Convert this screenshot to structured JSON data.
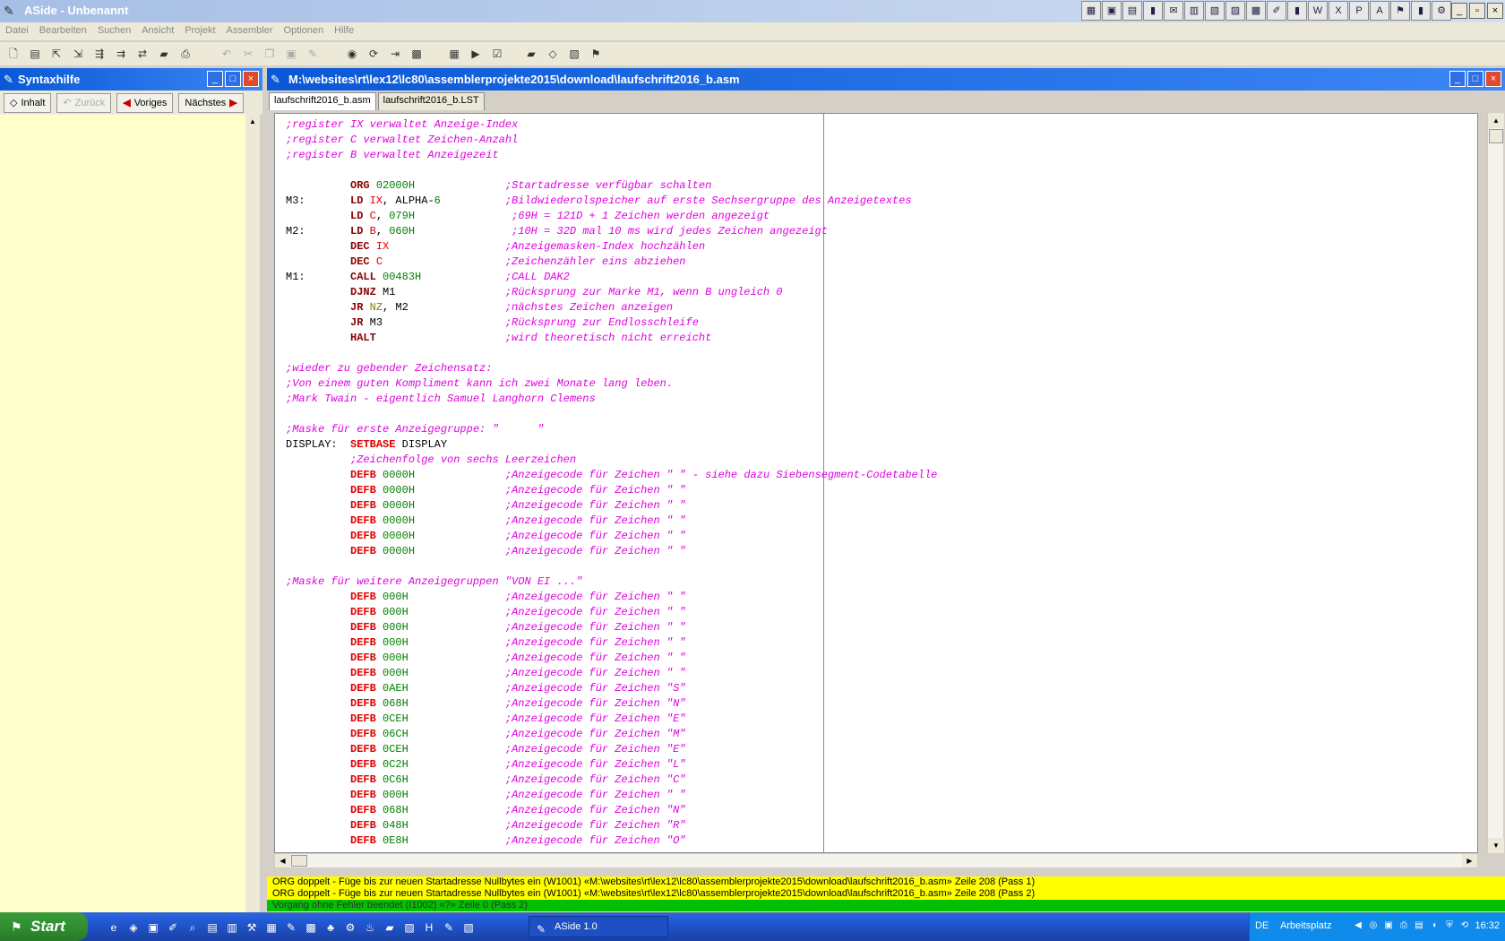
{
  "window": {
    "title": "ASide - Unbenannt"
  },
  "menu": [
    "Datei",
    "Bearbeiten",
    "Suchen",
    "Ansicht",
    "Projekt",
    "Assembler",
    "Optionen",
    "Hilfe"
  ],
  "syntax_panel": {
    "title": "Syntaxhilfe",
    "buttons": {
      "inhalt": "Inhalt",
      "zurueck": "Zurück",
      "voriges": "Voriges",
      "naechstes": "Nächstes"
    }
  },
  "editor": {
    "title": "M:\\websites\\rt\\lex12\\lc80\\assemblerprojekte2015\\download\\laufschrift2016_b.asm",
    "tabs": [
      "laufschrift2016_b.asm",
      "laufschrift2016_b.LST"
    ]
  },
  "code_lines": [
    [
      {
        "c": "cm",
        "t": ";register IX verwaltet Anzeige-Index"
      }
    ],
    [
      {
        "c": "cm",
        "t": ";register C verwaltet Zeichen-Anzahl"
      }
    ],
    [
      {
        "c": "cm",
        "t": ";register B verwaltet Anzeigezeit"
      }
    ],
    [],
    [
      {
        "c": "plain",
        "t": "          "
      },
      {
        "c": "kw",
        "t": "ORG"
      },
      {
        "c": "plain",
        "t": " "
      },
      {
        "c": "num",
        "t": "02000H"
      },
      {
        "c": "plain",
        "t": "              "
      },
      {
        "c": "cm",
        "t": ";Startadresse verfügbar schalten"
      }
    ],
    [
      {
        "c": "plain",
        "t": "M3:       "
      },
      {
        "c": "kw",
        "t": "LD"
      },
      {
        "c": "plain",
        "t": " "
      },
      {
        "c": "reg",
        "t": "IX"
      },
      {
        "c": "plain",
        "t": ", ALPHA-"
      },
      {
        "c": "num",
        "t": "6"
      },
      {
        "c": "plain",
        "t": "          "
      },
      {
        "c": "cm",
        "t": ";Bildwiederolspeicher auf erste Sechsergruppe des Anzeigetextes"
      }
    ],
    [
      {
        "c": "plain",
        "t": "          "
      },
      {
        "c": "kw",
        "t": "LD"
      },
      {
        "c": "plain",
        "t": " "
      },
      {
        "c": "reg",
        "t": "C"
      },
      {
        "c": "plain",
        "t": ", "
      },
      {
        "c": "num",
        "t": "079H"
      },
      {
        "c": "plain",
        "t": "               "
      },
      {
        "c": "cm",
        "t": ";69H = 121D + 1 Zeichen werden angezeigt"
      }
    ],
    [
      {
        "c": "plain",
        "t": "M2:       "
      },
      {
        "c": "kw",
        "t": "LD"
      },
      {
        "c": "plain",
        "t": " "
      },
      {
        "c": "reg",
        "t": "B"
      },
      {
        "c": "plain",
        "t": ", "
      },
      {
        "c": "num",
        "t": "060H"
      },
      {
        "c": "plain",
        "t": "               "
      },
      {
        "c": "cm",
        "t": ";10H = 32D mal 10 ms wird jedes Zeichen angezeigt"
      }
    ],
    [
      {
        "c": "plain",
        "t": "          "
      },
      {
        "c": "kw",
        "t": "DEC"
      },
      {
        "c": "plain",
        "t": " "
      },
      {
        "c": "reg",
        "t": "IX"
      },
      {
        "c": "plain",
        "t": "                  "
      },
      {
        "c": "cm",
        "t": ";Anzeigemasken-Index hochzählen"
      }
    ],
    [
      {
        "c": "plain",
        "t": "          "
      },
      {
        "c": "kw",
        "t": "DEC"
      },
      {
        "c": "plain",
        "t": " "
      },
      {
        "c": "reg",
        "t": "C"
      },
      {
        "c": "plain",
        "t": "                   "
      },
      {
        "c": "cm",
        "t": ";Zeichenzähler eins abziehen"
      }
    ],
    [
      {
        "c": "plain",
        "t": "M1:       "
      },
      {
        "c": "kw",
        "t": "CALL"
      },
      {
        "c": "plain",
        "t": " "
      },
      {
        "c": "num",
        "t": "00483H"
      },
      {
        "c": "plain",
        "t": "             "
      },
      {
        "c": "cm",
        "t": ";CALL DAK2"
      }
    ],
    [
      {
        "c": "plain",
        "t": "          "
      },
      {
        "c": "kw",
        "t": "DJNZ"
      },
      {
        "c": "plain",
        "t": " M1                 "
      },
      {
        "c": "cm",
        "t": ";Rücksprung zur Marke M1, wenn B ungleich 0"
      }
    ],
    [
      {
        "c": "plain",
        "t": "          "
      },
      {
        "c": "kw",
        "t": "JR"
      },
      {
        "c": "plain",
        "t": " "
      },
      {
        "c": "flag",
        "t": "NZ"
      },
      {
        "c": "plain",
        "t": ", M2               "
      },
      {
        "c": "cm",
        "t": ";nächstes Zeichen anzeigen"
      }
    ],
    [
      {
        "c": "plain",
        "t": "          "
      },
      {
        "c": "kw",
        "t": "JR"
      },
      {
        "c": "plain",
        "t": " M3                   "
      },
      {
        "c": "cm",
        "t": ";Rücksprung zur Endlosschleife"
      }
    ],
    [
      {
        "c": "plain",
        "t": "          "
      },
      {
        "c": "kw",
        "t": "HALT"
      },
      {
        "c": "plain",
        "t": "                    "
      },
      {
        "c": "cm",
        "t": ";wird theoretisch nicht erreicht"
      }
    ],
    [],
    [
      {
        "c": "cm",
        "t": ";wieder zu gebender Zeichensatz:"
      }
    ],
    [
      {
        "c": "cm",
        "t": ";Von einem guten Kompliment kann ich zwei Monate lang leben."
      }
    ],
    [
      {
        "c": "cm",
        "t": ";Mark Twain - eigentlich Samuel Langhorn Clemens"
      }
    ],
    [],
    [
      {
        "c": "cm",
        "t": ";Maske für erste Anzeigegruppe: \"      \""
      }
    ],
    [
      {
        "c": "plain",
        "t": "DISPLAY:  "
      },
      {
        "c": "kwr",
        "t": "SETBASE"
      },
      {
        "c": "plain",
        "t": " DISPLAY"
      }
    ],
    [
      {
        "c": "plain",
        "t": "          "
      },
      {
        "c": "cm",
        "t": ";Zeichenfolge von sechs Leerzeichen"
      }
    ],
    [
      {
        "c": "plain",
        "t": "          "
      },
      {
        "c": "kwr",
        "t": "DEFB"
      },
      {
        "c": "plain",
        "t": " "
      },
      {
        "c": "num",
        "t": "0000H"
      },
      {
        "c": "plain",
        "t": "              "
      },
      {
        "c": "cm",
        "t": ";Anzeigecode für Zeichen \" \" - siehe dazu Siebensegment-Codetabelle"
      }
    ],
    [
      {
        "c": "plain",
        "t": "          "
      },
      {
        "c": "kwr",
        "t": "DEFB"
      },
      {
        "c": "plain",
        "t": " "
      },
      {
        "c": "num",
        "t": "0000H"
      },
      {
        "c": "plain",
        "t": "              "
      },
      {
        "c": "cm",
        "t": ";Anzeigecode für Zeichen \" \""
      }
    ],
    [
      {
        "c": "plain",
        "t": "          "
      },
      {
        "c": "kwr",
        "t": "DEFB"
      },
      {
        "c": "plain",
        "t": " "
      },
      {
        "c": "num",
        "t": "0000H"
      },
      {
        "c": "plain",
        "t": "              "
      },
      {
        "c": "cm",
        "t": ";Anzeigecode für Zeichen \" \""
      }
    ],
    [
      {
        "c": "plain",
        "t": "          "
      },
      {
        "c": "kwr",
        "t": "DEFB"
      },
      {
        "c": "plain",
        "t": " "
      },
      {
        "c": "num",
        "t": "0000H"
      },
      {
        "c": "plain",
        "t": "              "
      },
      {
        "c": "cm",
        "t": ";Anzeigecode für Zeichen \" \""
      }
    ],
    [
      {
        "c": "plain",
        "t": "          "
      },
      {
        "c": "kwr",
        "t": "DEFB"
      },
      {
        "c": "plain",
        "t": " "
      },
      {
        "c": "num",
        "t": "0000H"
      },
      {
        "c": "plain",
        "t": "              "
      },
      {
        "c": "cm",
        "t": ";Anzeigecode für Zeichen \" \""
      }
    ],
    [
      {
        "c": "plain",
        "t": "          "
      },
      {
        "c": "kwr",
        "t": "DEFB"
      },
      {
        "c": "plain",
        "t": " "
      },
      {
        "c": "num",
        "t": "0000H"
      },
      {
        "c": "plain",
        "t": "              "
      },
      {
        "c": "cm",
        "t": ";Anzeigecode für Zeichen \" \""
      }
    ],
    [],
    [
      {
        "c": "cm",
        "t": ";Maske für weitere Anzeigegruppen \"VON EI ...\""
      }
    ],
    [
      {
        "c": "plain",
        "t": "          "
      },
      {
        "c": "kwr",
        "t": "DEFB"
      },
      {
        "c": "plain",
        "t": " "
      },
      {
        "c": "num",
        "t": "000H"
      },
      {
        "c": "plain",
        "t": "               "
      },
      {
        "c": "cm",
        "t": ";Anzeigecode für Zeichen \" \""
      }
    ],
    [
      {
        "c": "plain",
        "t": "          "
      },
      {
        "c": "kwr",
        "t": "DEFB"
      },
      {
        "c": "plain",
        "t": " "
      },
      {
        "c": "num",
        "t": "000H"
      },
      {
        "c": "plain",
        "t": "               "
      },
      {
        "c": "cm",
        "t": ";Anzeigecode für Zeichen \" \""
      }
    ],
    [
      {
        "c": "plain",
        "t": "          "
      },
      {
        "c": "kwr",
        "t": "DEFB"
      },
      {
        "c": "plain",
        "t": " "
      },
      {
        "c": "num",
        "t": "000H"
      },
      {
        "c": "plain",
        "t": "               "
      },
      {
        "c": "cm",
        "t": ";Anzeigecode für Zeichen \" \""
      }
    ],
    [
      {
        "c": "plain",
        "t": "          "
      },
      {
        "c": "kwr",
        "t": "DEFB"
      },
      {
        "c": "plain",
        "t": " "
      },
      {
        "c": "num",
        "t": "000H"
      },
      {
        "c": "plain",
        "t": "               "
      },
      {
        "c": "cm",
        "t": ";Anzeigecode für Zeichen \" \""
      }
    ],
    [
      {
        "c": "plain",
        "t": "          "
      },
      {
        "c": "kwr",
        "t": "DEFB"
      },
      {
        "c": "plain",
        "t": " "
      },
      {
        "c": "num",
        "t": "000H"
      },
      {
        "c": "plain",
        "t": "               "
      },
      {
        "c": "cm",
        "t": ";Anzeigecode für Zeichen \" \""
      }
    ],
    [
      {
        "c": "plain",
        "t": "          "
      },
      {
        "c": "kwr",
        "t": "DEFB"
      },
      {
        "c": "plain",
        "t": " "
      },
      {
        "c": "num",
        "t": "000H"
      },
      {
        "c": "plain",
        "t": "               "
      },
      {
        "c": "cm",
        "t": ";Anzeigecode für Zeichen \" \""
      }
    ],
    [
      {
        "c": "plain",
        "t": "          "
      },
      {
        "c": "kwr",
        "t": "DEFB"
      },
      {
        "c": "plain",
        "t": " "
      },
      {
        "c": "num",
        "t": "0AEH"
      },
      {
        "c": "plain",
        "t": "               "
      },
      {
        "c": "cm",
        "t": ";Anzeigecode für Zeichen \"S\""
      }
    ],
    [
      {
        "c": "plain",
        "t": "          "
      },
      {
        "c": "kwr",
        "t": "DEFB"
      },
      {
        "c": "plain",
        "t": " "
      },
      {
        "c": "num",
        "t": "068H"
      },
      {
        "c": "plain",
        "t": "               "
      },
      {
        "c": "cm",
        "t": ";Anzeigecode für Zeichen \"N\""
      }
    ],
    [
      {
        "c": "plain",
        "t": "          "
      },
      {
        "c": "kwr",
        "t": "DEFB"
      },
      {
        "c": "plain",
        "t": " "
      },
      {
        "c": "num",
        "t": "0CEH"
      },
      {
        "c": "plain",
        "t": "               "
      },
      {
        "c": "cm",
        "t": ";Anzeigecode für Zeichen \"E\""
      }
    ],
    [
      {
        "c": "plain",
        "t": "          "
      },
      {
        "c": "kwr",
        "t": "DEFB"
      },
      {
        "c": "plain",
        "t": " "
      },
      {
        "c": "num",
        "t": "06CH"
      },
      {
        "c": "plain",
        "t": "               "
      },
      {
        "c": "cm",
        "t": ";Anzeigecode für Zeichen \"M\""
      }
    ],
    [
      {
        "c": "plain",
        "t": "          "
      },
      {
        "c": "kwr",
        "t": "DEFB"
      },
      {
        "c": "plain",
        "t": " "
      },
      {
        "c": "num",
        "t": "0CEH"
      },
      {
        "c": "plain",
        "t": "               "
      },
      {
        "c": "cm",
        "t": ";Anzeigecode für Zeichen \"E\""
      }
    ],
    [
      {
        "c": "plain",
        "t": "          "
      },
      {
        "c": "kwr",
        "t": "DEFB"
      },
      {
        "c": "plain",
        "t": " "
      },
      {
        "c": "num",
        "t": "0C2H"
      },
      {
        "c": "plain",
        "t": "               "
      },
      {
        "c": "cm",
        "t": ";Anzeigecode für Zeichen \"L\""
      }
    ],
    [
      {
        "c": "plain",
        "t": "          "
      },
      {
        "c": "kwr",
        "t": "DEFB"
      },
      {
        "c": "plain",
        "t": " "
      },
      {
        "c": "num",
        "t": "0C6H"
      },
      {
        "c": "plain",
        "t": "               "
      },
      {
        "c": "cm",
        "t": ";Anzeigecode für Zeichen \"C\""
      }
    ],
    [
      {
        "c": "plain",
        "t": "          "
      },
      {
        "c": "kwr",
        "t": "DEFB"
      },
      {
        "c": "plain",
        "t": " "
      },
      {
        "c": "num",
        "t": "000H"
      },
      {
        "c": "plain",
        "t": "               "
      },
      {
        "c": "cm",
        "t": ";Anzeigecode für Zeichen \" \""
      }
    ],
    [
      {
        "c": "plain",
        "t": "          "
      },
      {
        "c": "kwr",
        "t": "DEFB"
      },
      {
        "c": "plain",
        "t": " "
      },
      {
        "c": "num",
        "t": "068H"
      },
      {
        "c": "plain",
        "t": "               "
      },
      {
        "c": "cm",
        "t": ";Anzeigecode für Zeichen \"N\""
      }
    ],
    [
      {
        "c": "plain",
        "t": "          "
      },
      {
        "c": "kwr",
        "t": "DEFB"
      },
      {
        "c": "plain",
        "t": " "
      },
      {
        "c": "num",
        "t": "048H"
      },
      {
        "c": "plain",
        "t": "               "
      },
      {
        "c": "cm",
        "t": ";Anzeigecode für Zeichen \"R\""
      }
    ],
    [
      {
        "c": "plain",
        "t": "          "
      },
      {
        "c": "kwr",
        "t": "DEFB"
      },
      {
        "c": "plain",
        "t": " "
      },
      {
        "c": "num",
        "t": "0E8H"
      },
      {
        "c": "plain",
        "t": "               "
      },
      {
        "c": "cm",
        "t": ";Anzeigecode für Zeichen \"O\""
      }
    ]
  ],
  "messages": [
    "ORG doppelt - Füge bis zur neuen Startadresse Nullbytes ein (W1001) «M:\\websites\\rt\\lex12\\lc80\\assemblerprojekte2015\\download\\laufschrift2016_b.asm» Zeile 208 (Pass 1)",
    "ORG doppelt - Füge bis zur neuen Startadresse Nullbytes ein (W1001) «M:\\websites\\rt\\lex12\\lc80\\assemblerprojekte2015\\download\\laufschrift2016_b.asm» Zeile 208 (Pass 2)",
    "Vorgang ohne Fehler beendet (I1002) «?» Zeile 0 (Pass 2)"
  ],
  "taskbar": {
    "start": "Start",
    "task": "ASide 1.0",
    "lang": "DE",
    "arbeitsplatz": "Arbeitsplatz",
    "clock": "16:32"
  },
  "colors": {
    "comment": "#e000e0",
    "keyword": "#8b0000",
    "number": "#008000",
    "title_active": "#0a58d7",
    "side_bg": "#ffffcc",
    "message_bg": "#ffff00"
  }
}
